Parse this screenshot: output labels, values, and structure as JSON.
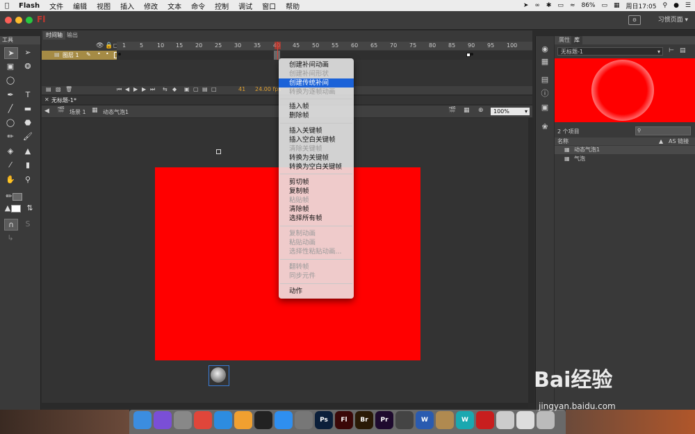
{
  "menubar": {
    "app": "Flash",
    "items": [
      "文件",
      "编辑",
      "视图",
      "插入",
      "修改",
      "文本",
      "命令",
      "控制",
      "调试",
      "窗口",
      "帮助"
    ],
    "battery": "86%",
    "clock": "周日17:05"
  },
  "titlebar": {
    "app_badge": "Fl",
    "workspace": "习惯页面"
  },
  "tools": {
    "title": "工具"
  },
  "timeline": {
    "tabs": [
      "时间轴",
      "输出"
    ],
    "ticks": [
      "1",
      "5",
      "10",
      "15",
      "20",
      "25",
      "30",
      "35",
      "40",
      "45",
      "50",
      "55",
      "60",
      "65",
      "70",
      "75",
      "80",
      "85",
      "90",
      "95",
      "100"
    ],
    "layer_name": "图层 1",
    "current_frame": "41",
    "fps": "24.00 fps"
  },
  "document": {
    "tab": "无标题-1*",
    "scene": "场景 1",
    "symbol": "动态气泡1",
    "zoom": "100%"
  },
  "library": {
    "tabs": [
      "属性",
      "库"
    ],
    "doc_select": "无标题-1",
    "count": "2 个项目",
    "col_name": "名称",
    "col_link": "AS 链接",
    "items": [
      "动态气泡1",
      "气泡"
    ]
  },
  "context_menu": {
    "items": [
      {
        "label": "创建补间动画",
        "state": "enabled"
      },
      {
        "label": "创建补间形状",
        "state": "disabled"
      },
      {
        "label": "创建传统补间",
        "state": "highlighted"
      },
      {
        "label": "转换为逐帧动画",
        "state": "disabled"
      },
      {
        "label": "插入帧",
        "state": "enabled"
      },
      {
        "label": "删除帧",
        "state": "enabled"
      },
      {
        "label": "插入关键帧",
        "state": "enabled"
      },
      {
        "label": "插入空白关键帧",
        "state": "enabled"
      },
      {
        "label": "清除关键帧",
        "state": "disabled"
      },
      {
        "label": "转换为关键帧",
        "state": "enabled"
      },
      {
        "label": "转换为空白关键帧",
        "state": "enabled"
      },
      {
        "label": "剪切帧",
        "state": "enabled"
      },
      {
        "label": "复制帧",
        "state": "enabled"
      },
      {
        "label": "粘贴帧",
        "state": "disabled"
      },
      {
        "label": "清除帧",
        "state": "enabled"
      },
      {
        "label": "选择所有帧",
        "state": "enabled"
      },
      {
        "label": "复制动画",
        "state": "disabled"
      },
      {
        "label": "粘贴动画",
        "state": "disabled"
      },
      {
        "label": "选择性粘贴动画...",
        "state": "disabled"
      },
      {
        "label": "翻转帧",
        "state": "disabled"
      },
      {
        "label": "同步元件",
        "state": "disabled"
      },
      {
        "label": "动作",
        "state": "enabled"
      }
    ]
  },
  "dock": {
    "apps": [
      {
        "name": "finder-icon",
        "label": "",
        "color": "#3b8de0"
      },
      {
        "name": "siri-icon",
        "label": "",
        "color": "#7a4fd6"
      },
      {
        "name": "launchpad-icon",
        "label": "",
        "color": "#888888"
      },
      {
        "name": "chrome-icon",
        "label": "",
        "color": "#e0463a"
      },
      {
        "name": "safari-icon",
        "label": "",
        "color": "#2d8ce0"
      },
      {
        "name": "photos-icon",
        "label": "",
        "color": "#f0a030"
      },
      {
        "name": "qq-icon",
        "label": "",
        "color": "#222222"
      },
      {
        "name": "appstore-icon",
        "label": "",
        "color": "#2f8ff0"
      },
      {
        "name": "system-preferences-icon",
        "label": "",
        "color": "#777777"
      },
      {
        "name": "photoshop-icon",
        "label": "Ps",
        "color": "#0b1f3a"
      },
      {
        "name": "flash-icon",
        "label": "Fl",
        "color": "#3a0808"
      },
      {
        "name": "bridge-icon",
        "label": "Br",
        "color": "#2a1a06"
      },
      {
        "name": "premiere-icon",
        "label": "Pr",
        "color": "#1e0a2e"
      },
      {
        "name": "quicktime-icon",
        "label": "",
        "color": "#444444"
      },
      {
        "name": "word-icon",
        "label": "W",
        "color": "#2a5bb0"
      },
      {
        "name": "archive-icon",
        "label": "",
        "color": "#b08a50"
      },
      {
        "name": "wunderlist-icon",
        "label": "W",
        "color": "#1aa8b0"
      },
      {
        "name": "flash-player-icon",
        "label": "",
        "color": "#c81e1e"
      },
      {
        "name": "screenshot-icon",
        "label": "",
        "color": "#cccccc"
      },
      {
        "name": "preview-icon",
        "label": "",
        "color": "#dddddd"
      },
      {
        "name": "trash-icon",
        "label": "",
        "color": "#bbbbbb"
      }
    ]
  },
  "watermark": {
    "brand": "Bai经验",
    "url": "jingyan.baidu.com"
  }
}
